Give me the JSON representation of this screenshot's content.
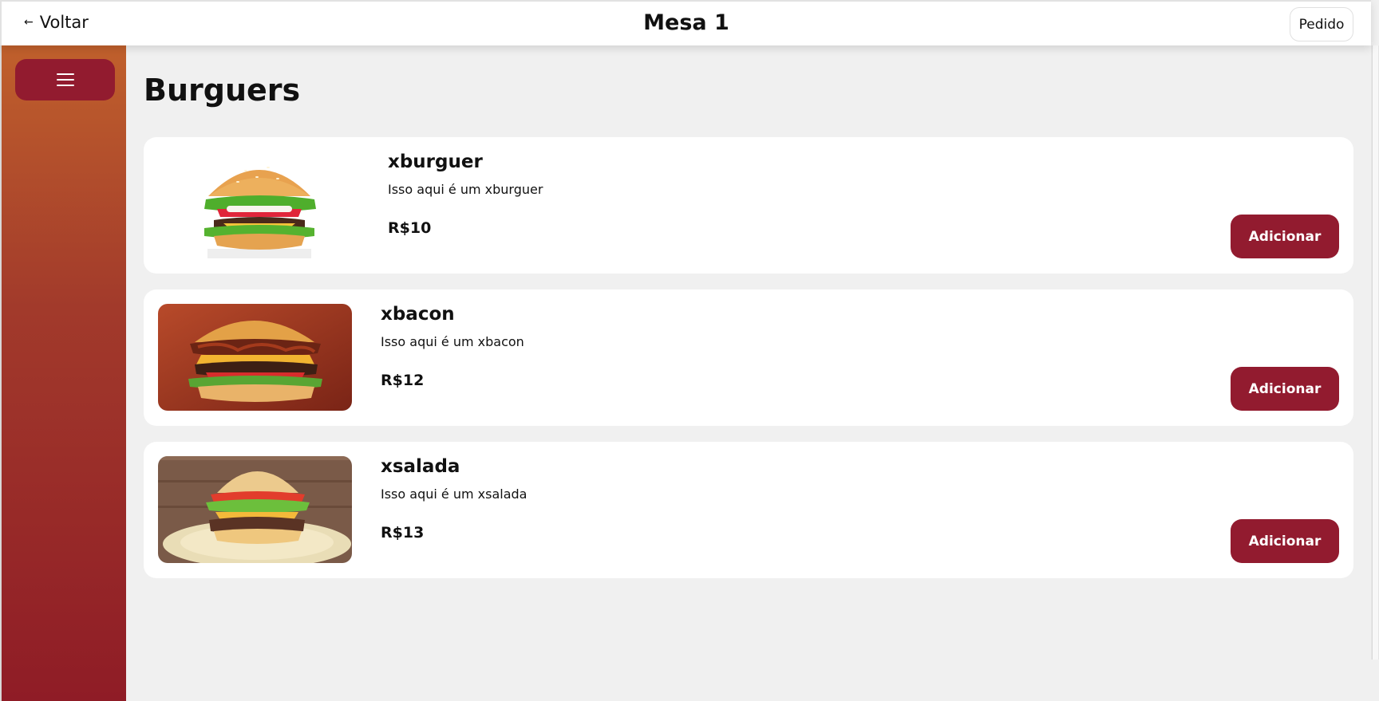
{
  "header": {
    "back_label": "Voltar",
    "title": "Mesa 1",
    "order_label": "Pedido"
  },
  "sidebar": {
    "menu_icon": "hamburger-menu-icon"
  },
  "main": {
    "section_title": "Burguers",
    "items": [
      {
        "name": "xburguer",
        "description": "Isso aqui é um xburguer",
        "price": "R$10",
        "button_label": "Adicionar"
      },
      {
        "name": "xbacon",
        "description": "Isso aqui é um xbacon",
        "price": "R$12",
        "button_label": "Adicionar"
      },
      {
        "name": "xsalada",
        "description": "Isso aqui é um xsalada",
        "price": "R$13",
        "button_label": "Adicionar"
      }
    ]
  },
  "colors": {
    "accent": "#921b2f",
    "sidebar_top": "#c0602c",
    "sidebar_bottom": "#8f1c26",
    "background": "#f0f0f0"
  }
}
